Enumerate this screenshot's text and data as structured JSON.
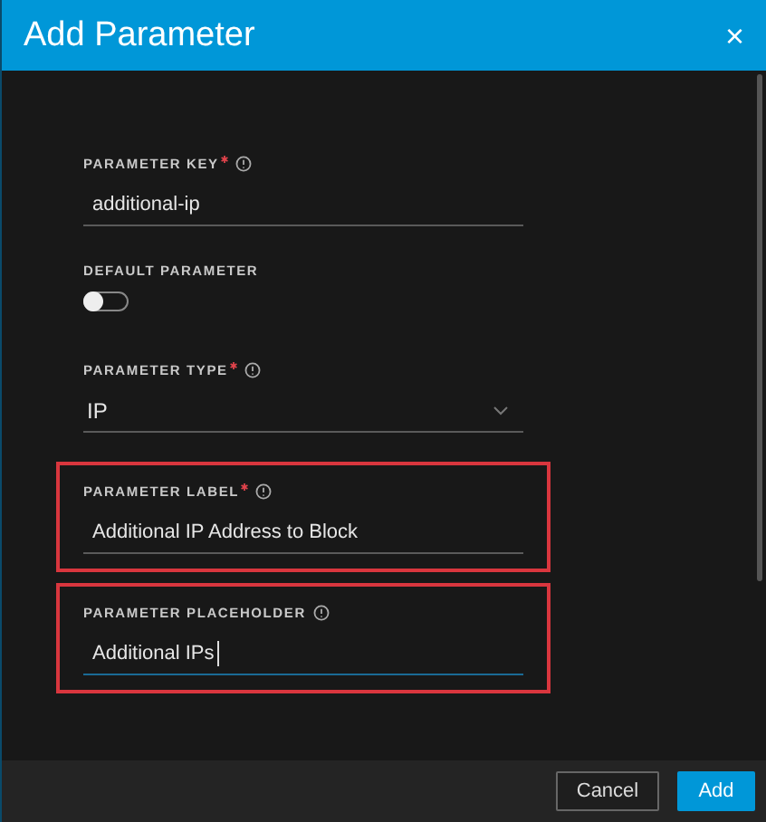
{
  "window": {
    "title": "Add Parameter",
    "close": "×"
  },
  "fields": [
    {
      "kind": "text",
      "label": "PARAMETER KEY",
      "required": true,
      "info": true,
      "value": "additional-ip",
      "highlighted": false,
      "focused": false
    },
    {
      "kind": "toggle",
      "label": "DEFAULT PARAMETER",
      "required": false,
      "info": false,
      "on": false,
      "highlighted": false
    },
    {
      "kind": "select",
      "label": "PARAMETER TYPE",
      "required": true,
      "info": true,
      "value": "IP",
      "highlighted": false,
      "focused": false
    },
    {
      "kind": "text",
      "label": "PARAMETER LABEL",
      "required": true,
      "info": true,
      "value": "Additional IP Address to Block",
      "highlighted": true,
      "focused": false
    },
    {
      "kind": "text",
      "label": "PARAMETER PLACEHOLDER",
      "required": false,
      "info": true,
      "value": "Additional IPs",
      "highlighted": true,
      "focused": true
    }
  ],
  "buttons": [
    {
      "label": "Cancel",
      "kind": "secondary"
    },
    {
      "label": "Add",
      "kind": "primary"
    }
  ]
}
